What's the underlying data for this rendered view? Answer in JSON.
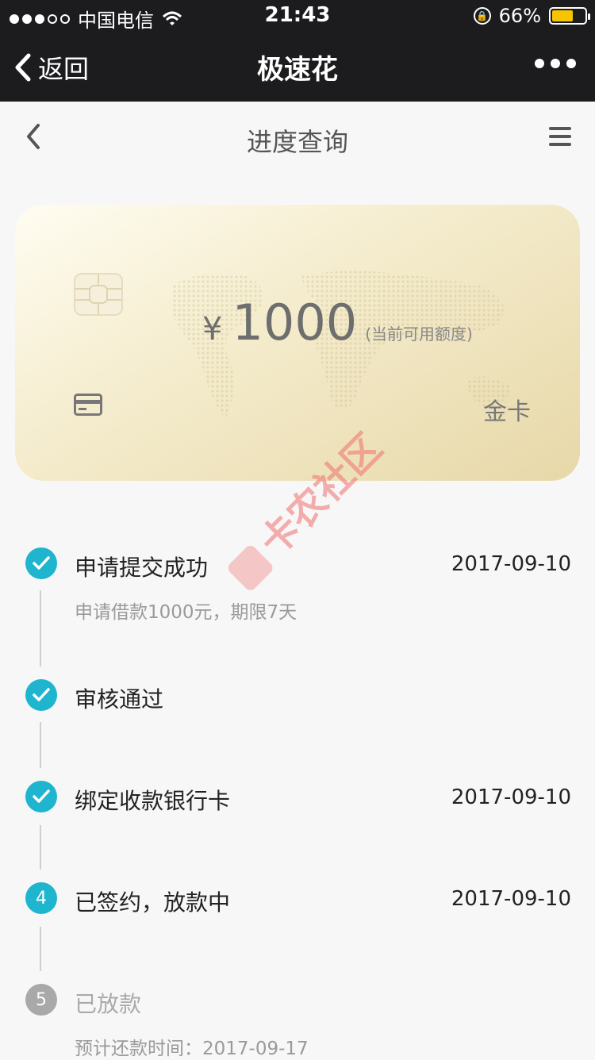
{
  "status_bar": {
    "carrier": "中国电信",
    "time": "21:43",
    "battery_percent": "66%",
    "battery_level": 0.66,
    "signal_bars": 3
  },
  "nav": {
    "back_label": "返回",
    "title": "极速花",
    "more_icon": "more-dots-icon"
  },
  "page": {
    "title": "进度查询"
  },
  "card": {
    "currency": "¥",
    "amount": "1000",
    "amount_note": "(当前可用额度)",
    "card_type": "金卡"
  },
  "watermark": "卡农社区",
  "steps": [
    {
      "index": "1",
      "status": "done",
      "title": "申请提交成功",
      "date": "2017-09-10",
      "sub": "申请借款1000元，期限7天"
    },
    {
      "index": "2",
      "status": "done",
      "title": "审核通过",
      "date": "",
      "sub": ""
    },
    {
      "index": "3",
      "status": "done",
      "title": "绑定收款银行卡",
      "date": "2017-09-10",
      "sub": ""
    },
    {
      "index": "4",
      "status": "current",
      "title": "已签约，放款中",
      "date": "2017-09-10",
      "sub": ""
    },
    {
      "index": "5",
      "status": "pending",
      "title": "已放款",
      "date": "",
      "sub": "预计还款时间：2017-09-17"
    }
  ],
  "colors": {
    "accent": "#1fb5cf",
    "nav_bg": "#1c1c1e",
    "pending": "#a9a9a9"
  }
}
